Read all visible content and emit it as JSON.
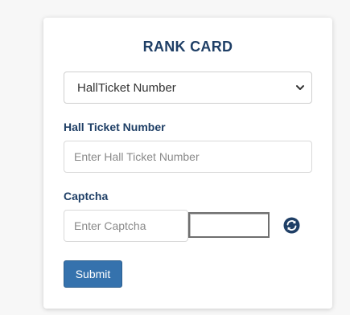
{
  "colors": {
    "title": "#1f3f66",
    "label": "#1f3f66",
    "button": "#3572ad",
    "refresh_icon": "#1f3f66"
  },
  "card": {
    "title": "RANK CARD",
    "select": {
      "value": "HallTicket Number",
      "icon": "chevron-down-icon"
    },
    "hall_ticket": {
      "label": "Hall Ticket Number",
      "placeholder": "Enter Hall Ticket Number"
    },
    "captcha": {
      "label": "Captcha",
      "placeholder": "Enter Captcha",
      "refresh_icon": "refresh-icon"
    },
    "submit_label": "Submit"
  }
}
